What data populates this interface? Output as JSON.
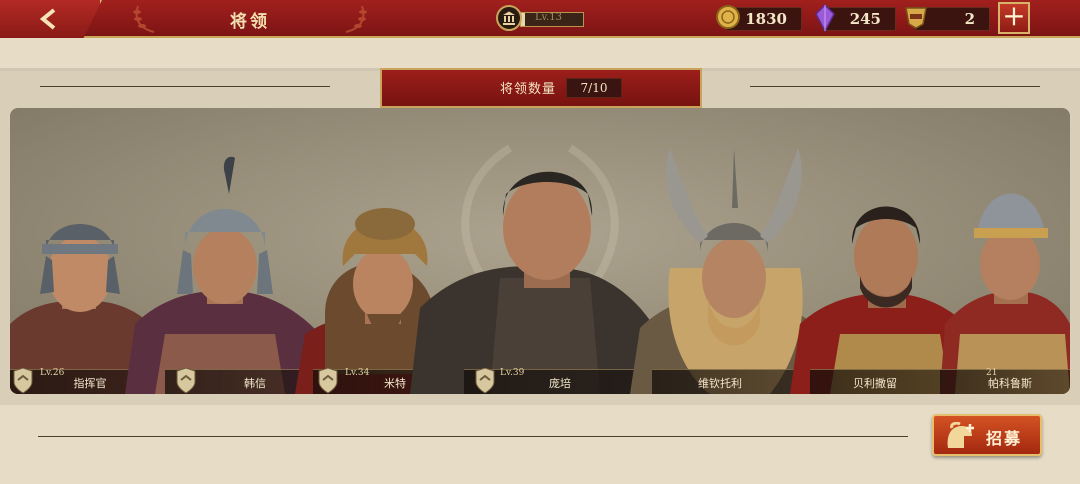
{
  "header": {
    "title": "将领",
    "level_text": "Lv.13",
    "level_progress": 0.07,
    "resources": [
      {
        "name": "gold",
        "icon": "gold-coin-icon",
        "value": "1830"
      },
      {
        "name": "gem",
        "icon": "purple-gem-icon",
        "value": "245"
      },
      {
        "name": "vip",
        "icon": "vip-badge-icon",
        "value": "2"
      }
    ],
    "add_label": "+"
  },
  "panel": {
    "count_label": "将领数量",
    "count_value": "7/10"
  },
  "generals": [
    {
      "name": "指挥官",
      "level": "Lv.26"
    },
    {
      "name": "韩信",
      "level": ""
    },
    {
      "name": "米特",
      "level": "Lv.34"
    },
    {
      "name": "庞培",
      "level": "Lv.39"
    },
    {
      "name": "维钦托利",
      "level": ""
    },
    {
      "name": "贝利撒留",
      "level": ""
    },
    {
      "name": "帕科鲁斯",
      "level": "21"
    }
  ],
  "footer": {
    "recruit_label": "招募"
  },
  "colors": {
    "header_red": "#8f1a17",
    "gold_trim": "#c9a55a",
    "panel_bg": "#e7ddc7",
    "recruit_orange": "#c0401c"
  }
}
